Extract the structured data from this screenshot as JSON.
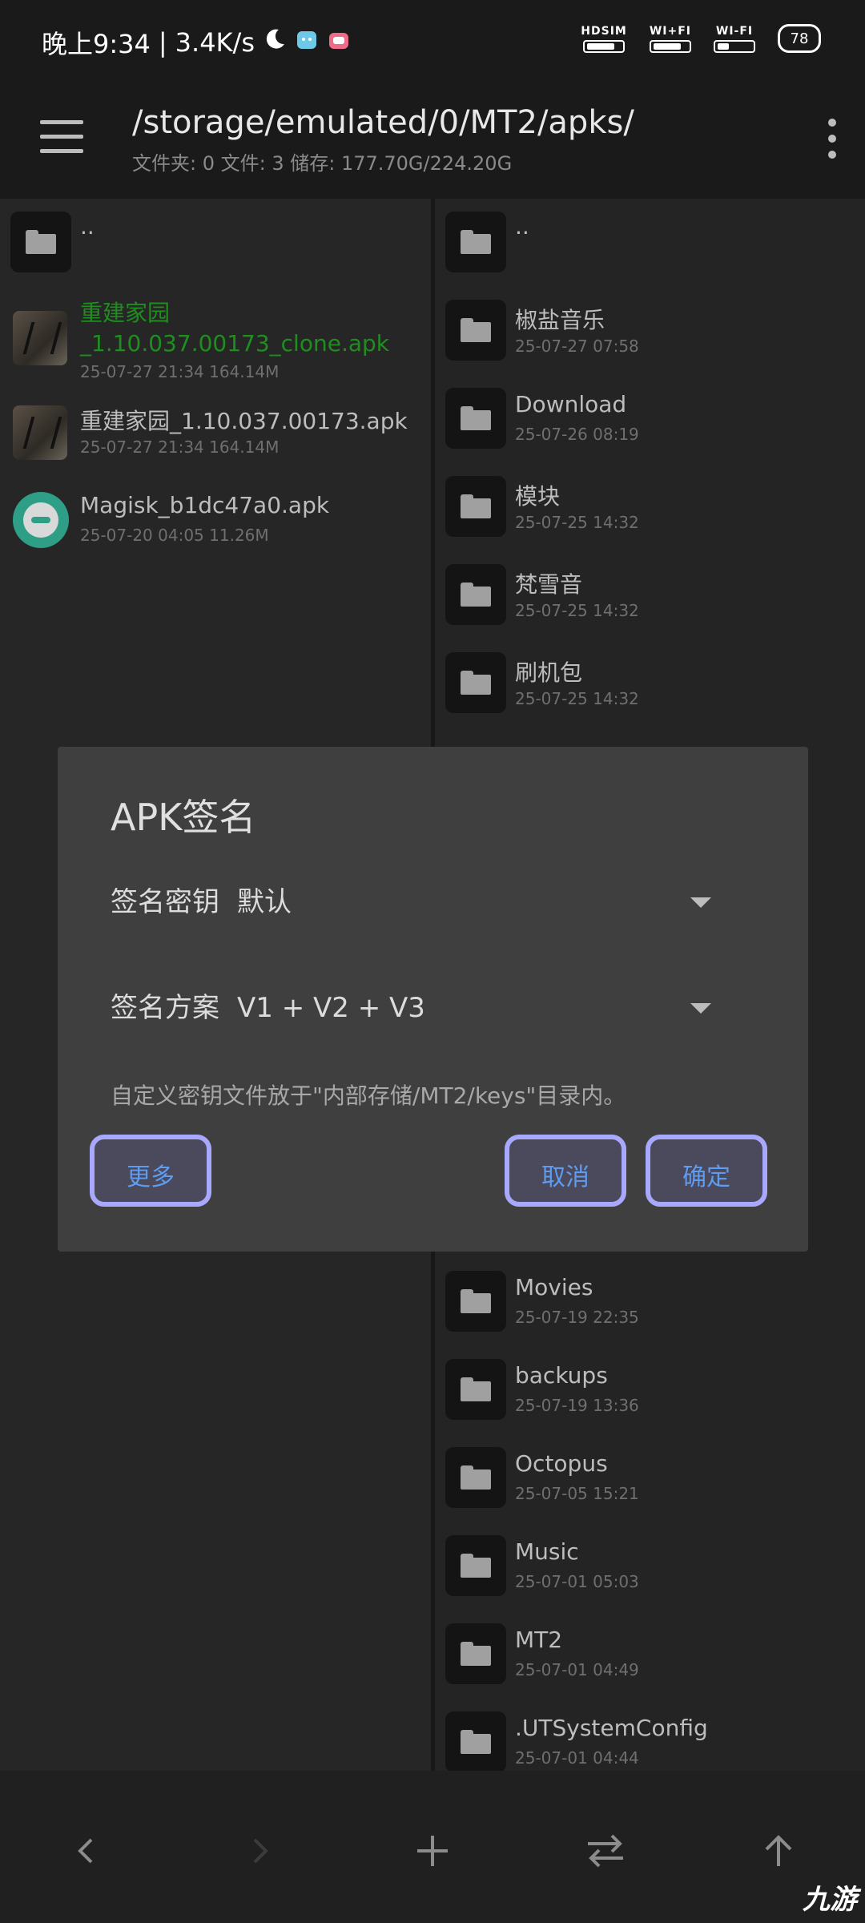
{
  "status_bar": {
    "time": "晚上9:34",
    "speed": "3.4K/s",
    "sim1_label": "HDSIM",
    "wifi_call_label": "WI+FI",
    "wifi_label": "WI-FI",
    "battery": "78"
  },
  "app_bar": {
    "path": "/storage/emulated/0/MT2/apks/",
    "summary": "文件夹: 0  文件: 3  储存: 177.70G/224.20G"
  },
  "left_pane": {
    "parent": "..",
    "files": [
      {
        "name_line1": "重建家园",
        "name_line2": "_1.10.037.00173_clone.apk",
        "meta": "25-07-27 21:34   164.14M",
        "color": "#1e8f1e"
      },
      {
        "name": "重建家园_1.10.037.00173.apk",
        "meta": "25-07-27 21:34   164.14M"
      },
      {
        "name": "Magisk_b1dc47a0.apk",
        "meta": "25-07-20 04:05   11.26M"
      }
    ]
  },
  "right_pane": {
    "parent": "..",
    "folders_top": [
      {
        "name": "椒盐音乐",
        "meta": "25-07-27 07:58"
      },
      {
        "name": "Download",
        "meta": "25-07-26 08:19"
      },
      {
        "name": "模块",
        "meta": "25-07-25 14:32"
      },
      {
        "name": "梵雪音",
        "meta": "25-07-25 14:32"
      },
      {
        "name": "刷机包",
        "meta": "25-07-25 14:32"
      }
    ],
    "folders_bottom": [
      {
        "name": "Movies",
        "meta": "25-07-19 22:35"
      },
      {
        "name": "backups",
        "meta": "25-07-19 13:36"
      },
      {
        "name": "Octopus",
        "meta": "25-07-05 15:21"
      },
      {
        "name": "Music",
        "meta": "25-07-01 05:03"
      },
      {
        "name": "MT2",
        "meta": "25-07-01 04:49"
      },
      {
        "name": ".UTSystemConfig",
        "meta": "25-07-01 04:44"
      }
    ]
  },
  "dialog": {
    "title": "APK签名",
    "key_label": "签名密钥",
    "key_value": "默认",
    "scheme_label": "签名方案",
    "scheme_value": "V1 + V2 + V3",
    "hint": "自定义密钥文件放于\"内部存储/MT2/keys\"目录内。",
    "btn_more": "更多",
    "btn_cancel": "取消",
    "btn_ok": "确定",
    "accent": "#5f9cf0",
    "highlight": "#a9a8ff"
  },
  "bottom_bar": {
    "icons": [
      "back-icon",
      "forward-icon",
      "add-icon",
      "swap-icon",
      "up-icon"
    ]
  },
  "watermark": "九游"
}
